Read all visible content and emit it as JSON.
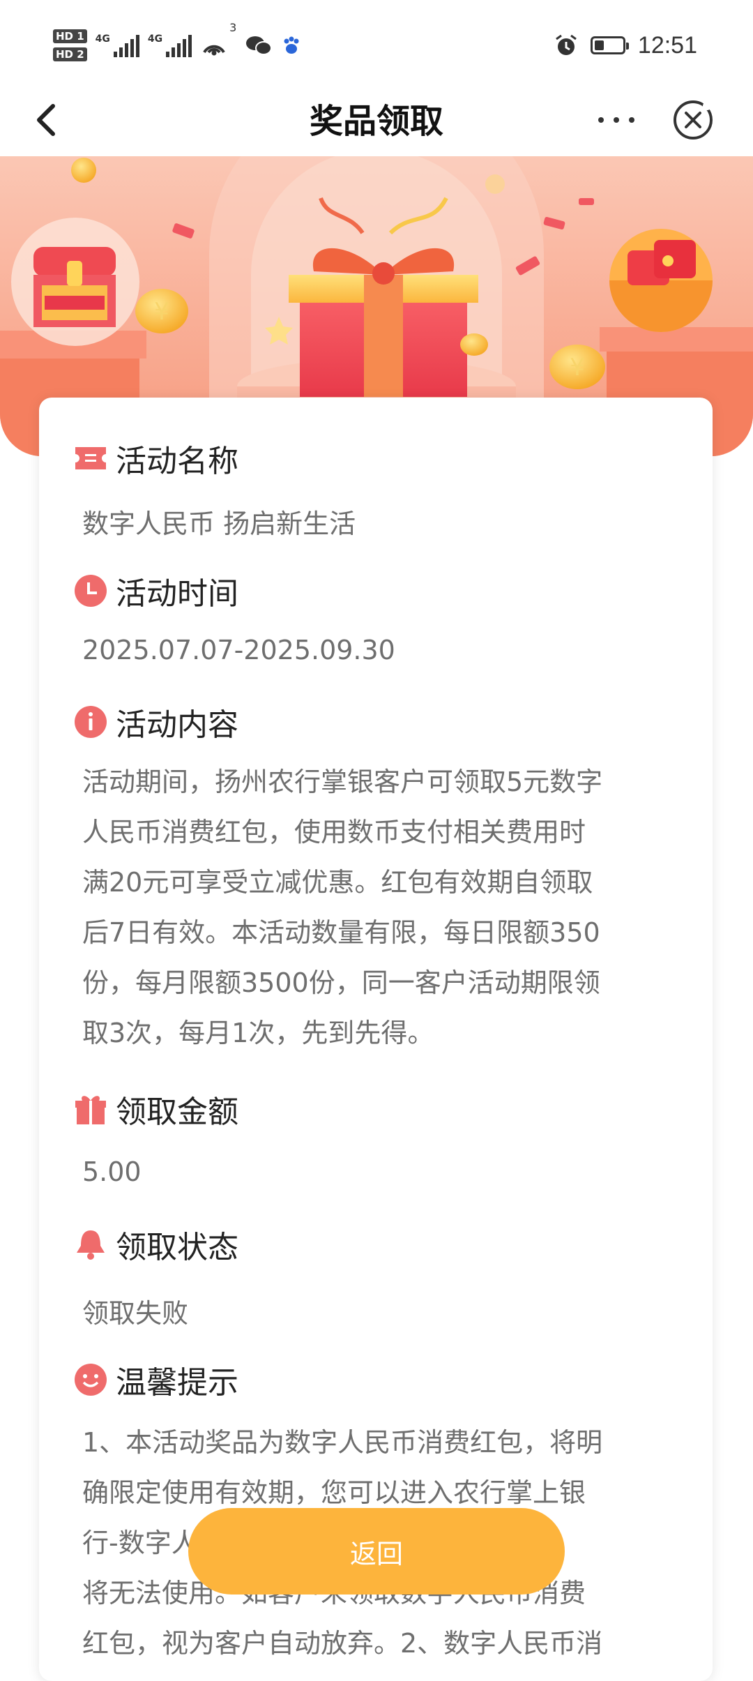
{
  "status_bar": {
    "hd1": "HD 1",
    "hd2": "HD 2",
    "net1": "4G",
    "net2": "4G",
    "hotspot_sup": "3",
    "time": "12:51",
    "battery_level": 0.35
  },
  "nav": {
    "title": "奖品领取"
  },
  "sections": {
    "name": {
      "label": "活动名称",
      "value": "数字人民币 扬启新生活"
    },
    "time": {
      "label": "活动时间",
      "value": "2025.07.07-2025.09.30"
    },
    "content": {
      "label": "活动内容",
      "lines": [
        "活动期间，扬州农行掌银客户可领取5元数字",
        "人民币消费红包，使用数币支付相关费用时",
        "满20元可享受立减优惠。红包有效期自领取",
        "后7日有效。本活动数量有限，每日限额350",
        "份，每月限额3500份，同一客户活动期限领",
        "取3次，每月1次，先到先得。"
      ]
    },
    "amount": {
      "label": "领取金额",
      "value": "5.00"
    },
    "status": {
      "label": "领取状态",
      "value": "领取失败"
    },
    "tips": {
      "label": "温馨提示",
      "lines": [
        "1、本活动奖品为数字人民币消费红包，将明",
        "确限定使用有效期，您可以进入农行掌上银",
        "行-数字人民币查看红包，超过有效期",
        "将无法使用。如客户未领取数字人民币消费",
        "红包，视为客户自动放弃。2、数字人民币消"
      ]
    }
  },
  "return_button": "返回",
  "colors": {
    "accent": "#f07070",
    "icon_red": "#ef6b6b",
    "button": "#fdb43c",
    "text_gray": "#6e6e6e"
  }
}
